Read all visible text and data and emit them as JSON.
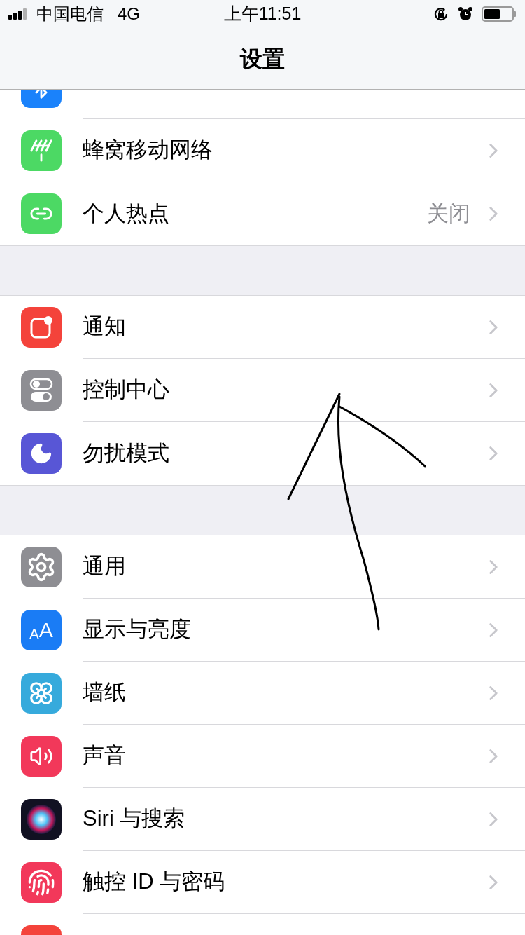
{
  "status_bar": {
    "carrier": "中国电信",
    "network": "4G",
    "time": "上午11:51"
  },
  "nav": {
    "title": "设置"
  },
  "sections": [
    {
      "rows": [
        {
          "kind": "bluetooth",
          "cut_top": true
        },
        {
          "kind": "cellular",
          "label": "蜂窝移动网络"
        },
        {
          "kind": "hotspot",
          "label": "个人热点",
          "value": "关闭"
        }
      ]
    },
    {
      "rows": [
        {
          "kind": "notifications",
          "label": "通知"
        },
        {
          "kind": "control",
          "label": "控制中心"
        },
        {
          "kind": "moon",
          "label": "勿扰模式"
        }
      ]
    },
    {
      "rows": [
        {
          "kind": "general",
          "label": "通用"
        },
        {
          "kind": "display",
          "label": "显示与亮度",
          "icon_text": [
            "A",
            "A"
          ]
        },
        {
          "kind": "wallpaper",
          "label": "墙纸"
        },
        {
          "kind": "sound",
          "label": "声音"
        },
        {
          "kind": "siri",
          "label": "Siri 与搜索"
        },
        {
          "kind": "touchid",
          "label": "触控 ID 与密码"
        },
        {
          "kind": "sos"
        }
      ]
    }
  ]
}
